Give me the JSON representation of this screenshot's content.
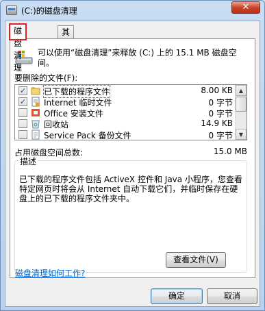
{
  "window": {
    "title": "(C:)的磁盘清理",
    "close_glyph": "✕"
  },
  "tabs": [
    {
      "label": "磁盘清理",
      "active": true
    },
    {
      "label": "其他选项",
      "active": false
    }
  ],
  "summary": "可以使用“磁盘清理”来释放 (C:) 上的 15.1 MB 磁盘空间。",
  "files_label": "要删除的文件(F):",
  "files": [
    {
      "checked": true,
      "name": "已下载的程序文件",
      "size": "8.00 KB",
      "icon": "folder-icon"
    },
    {
      "checked": true,
      "name": "Internet 临时文件",
      "size": "0 字节",
      "icon": "document-lock-icon"
    },
    {
      "checked": false,
      "name": "Office 安装文件",
      "size": "0 字节",
      "icon": "office-icon"
    },
    {
      "checked": false,
      "name": "回收站",
      "size": "14.9 KB",
      "icon": "recycle-bin-icon"
    },
    {
      "checked": false,
      "name": "Service Pack 备份文件",
      "size": "0 字节",
      "icon": "document-icon"
    }
  ],
  "total": {
    "label": "占用磁盘空间总数:",
    "value": "15.0 MB"
  },
  "description": {
    "legend": "描述",
    "text": "已下载的程序文件包括 ActiveX 控件和 Java 小程序，您查看特定网页时将会从 Internet 自动下载它们，并临时保存在硬盘上的已下载的程序文件夹中。"
  },
  "view_files_button": "查看文件(V)",
  "help_link": "磁盘清理如何工作?",
  "ok_button": "确定",
  "cancel_button": "取消",
  "colors": {
    "link": "#0066cc",
    "highlight_border": "#e42020",
    "check": "#1c3f93"
  }
}
